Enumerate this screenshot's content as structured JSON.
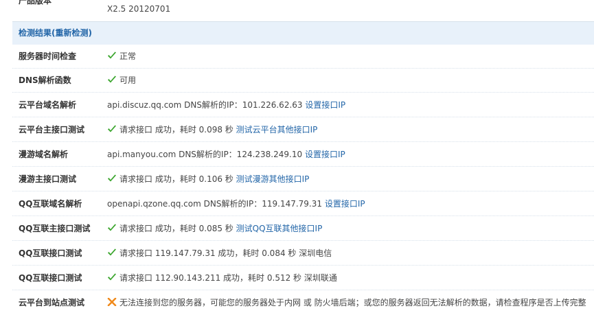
{
  "product": {
    "label": "产品版本",
    "value": "X2.5 20120701"
  },
  "section": {
    "title": "检测结果",
    "recheck": "重新检测"
  },
  "rows": [
    {
      "label": "服务器时间检查",
      "status": "正常"
    },
    {
      "label": "DNS解析函数",
      "status": "可用"
    },
    {
      "label": "云平台域名解析",
      "text": "api.discuz.qq.com DNS解析的IP：101.226.62.63",
      "link": "设置接口IP"
    },
    {
      "label": "云平台主接口测试",
      "text": "请求接口 成功，耗时 0.098 秒",
      "link": "测试云平台其他接口IP"
    },
    {
      "label": "漫游域名解析",
      "text": "api.manyou.com DNS解析的IP：124.238.249.10",
      "link": "设置接口IP"
    },
    {
      "label": "漫游主接口测试",
      "text": "请求接口 成功，耗时 0.106 秒",
      "link": "测试漫游其他接口IP"
    },
    {
      "label": "QQ互联域名解析",
      "text": "openapi.qzone.qq.com DNS解析的IP：119.147.79.31",
      "link": "设置接口IP"
    },
    {
      "label": "QQ互联主接口测试",
      "text": "请求接口 成功，耗时 0.085 秒",
      "link": "测试QQ互联其他接口IP"
    },
    {
      "label": "QQ互联接口测试",
      "text": "请求接口 119.147.79.31 成功，耗时 0.084 秒 深圳电信"
    },
    {
      "label": "QQ互联接口测试",
      "text": "请求接口 112.90.143.211 成功，耗时 0.512 秒 深圳联通"
    },
    {
      "label": "云平台到站点测试",
      "text": "无法连接到您的服务器，可能您的服务器处于内网 或 防火墙后端；或您的服务器返回无法解析的数据，请检查程序是否上传完整"
    }
  ],
  "icons": {
    "ok": "check-icon",
    "fail": "cross-icon"
  },
  "colors": {
    "link": "#2366a8",
    "ok": "#3aa52c",
    "fail": "#f08a1c",
    "section_bg": "#e8f1fa"
  }
}
